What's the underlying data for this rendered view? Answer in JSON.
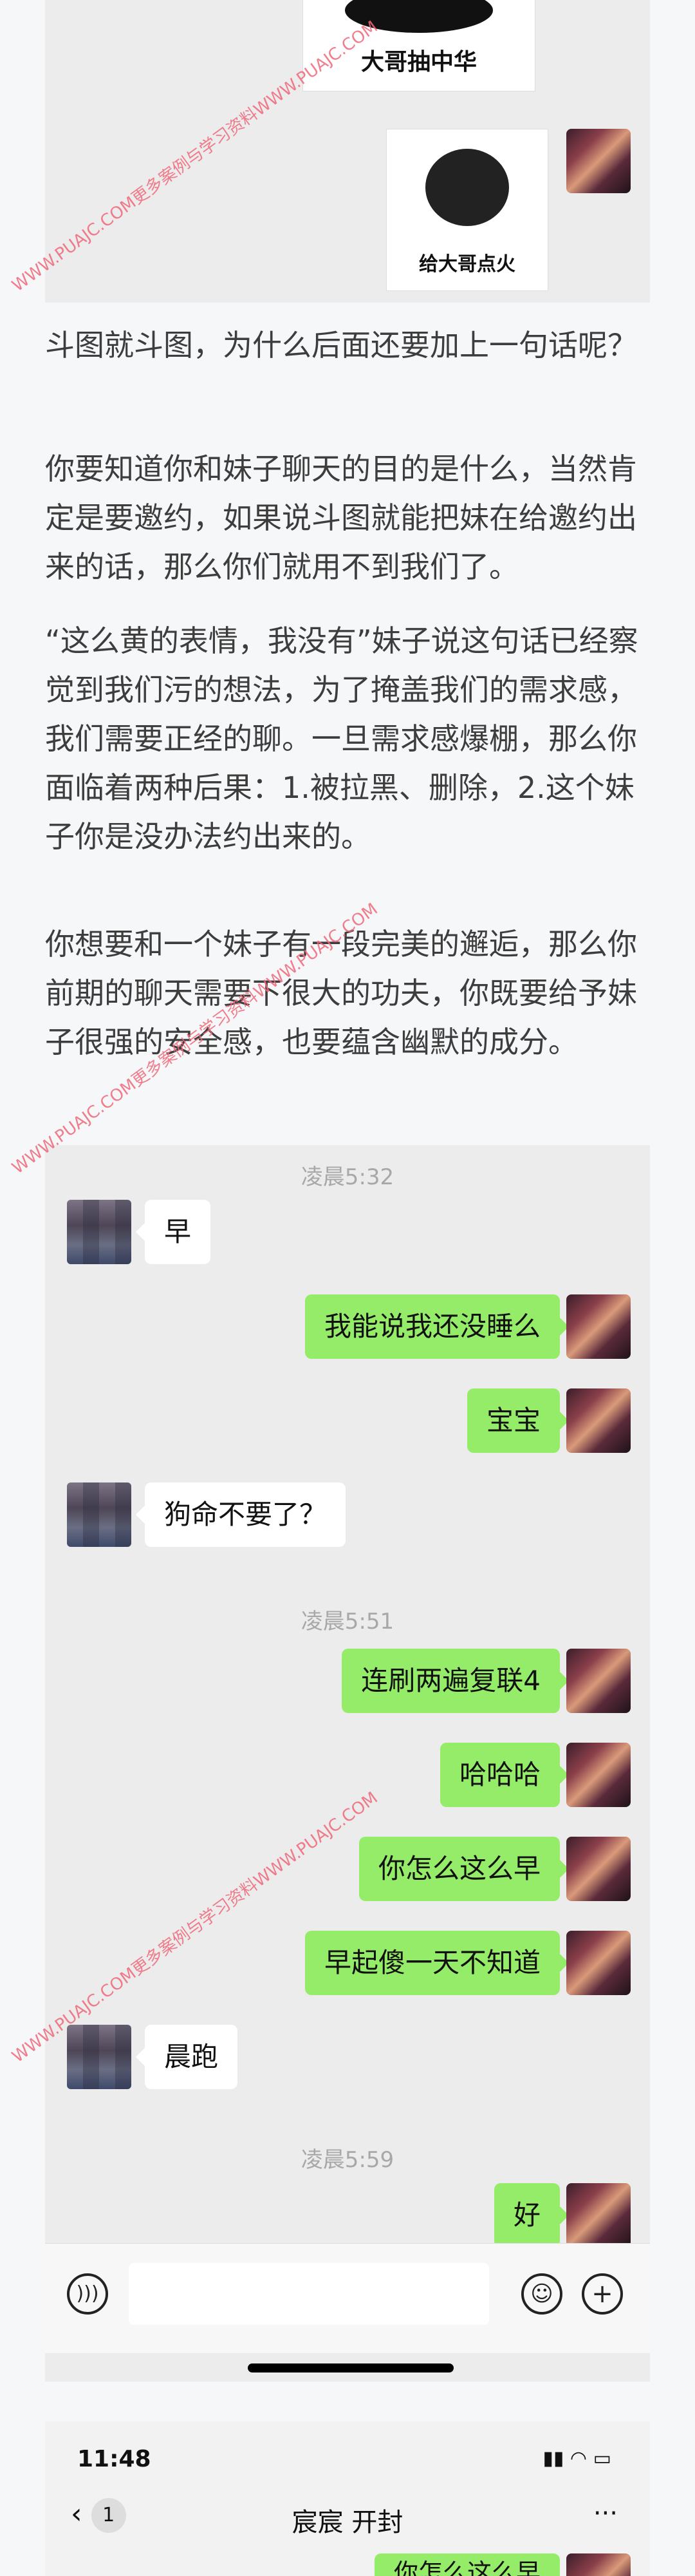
{
  "stickers": [
    {
      "caption": "大哥抽中华"
    },
    {
      "caption": "给大哥点火"
    }
  ],
  "article": {
    "paragraphs": [
      "斗图就斗图，为什么后面还要加上一句话呢？",
      "你要知道你和妹子聊天的目的是什么，当然肯定是要邀约，如果说斗图就能把妹在给邀约出来的话，那么你们就用不到我们了。",
      "“这么黄的表情，我没有”妹子说这句话已经察觉到我们污的想法，为了掩盖我们的需求感，我们需要正经的聊。一旦需求感爆棚，那么你面临着两种后果：1.被拉黑、删除，2.这个妹子你是没办法约出来的。",
      "你想要和一个妹子有一段完美的邂逅，那么你前期的聊天需要下很大的功夫，你既要给予妹子很强的安全感，也要蕴含幽默的成分。"
    ]
  },
  "chat": {
    "time1": "凌晨5:32",
    "time2": "凌晨5:51",
    "time3": "凌晨5:59",
    "messages": [
      "早",
      "我能说我还没睡么",
      "宝宝",
      "狗命不要了？",
      "连刷两遍复联4",
      "哈哈哈",
      "你怎么这么早",
      "早起傻一天不知道",
      "晨跑",
      "好"
    ]
  },
  "input_bar": {
    "voice_icon": "voice-icon",
    "emoji_icon": "emoji-icon",
    "plus_icon": "plus-icon"
  },
  "next_screenshot": {
    "time": "11:48",
    "back_count": "1",
    "title": "宸宸 开封",
    "more": "···",
    "partial_message": "你怎么这么早"
  },
  "watermark": "WWW.PUAJC.COM更多案例与学习资料WWW.PUAJC.COM"
}
